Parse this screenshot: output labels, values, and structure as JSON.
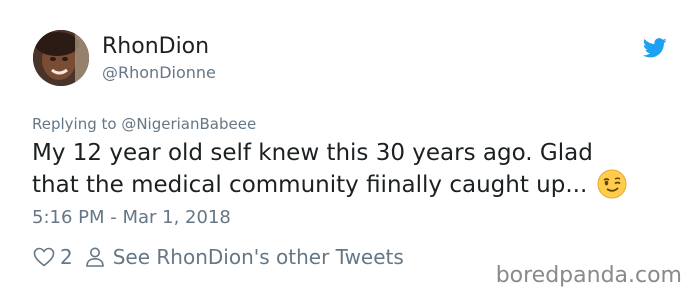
{
  "user": {
    "display_name": "RhonDion",
    "handle": "@RhonDionne"
  },
  "tweet": {
    "replying_to": "Replying to @NigerianBabeee",
    "text_line1": "My 12 year old self knew this 30 years ago. Glad",
    "text_line2": "that the medical community fiinally caught up...",
    "emoji": "winking-face",
    "timestamp": "5:16 PM - Mar 1, 2018"
  },
  "actions": {
    "like_count": "2",
    "see_other": "See RhonDion's other Tweets"
  },
  "watermark": "boredpanda.com",
  "colors": {
    "twitter_blue": "#1da1f2",
    "muted_text": "#657786",
    "main_text": "#1c2022"
  },
  "icons": [
    "twitter-bird-icon",
    "heart-icon",
    "person-icon",
    "winking-face-emoji"
  ]
}
